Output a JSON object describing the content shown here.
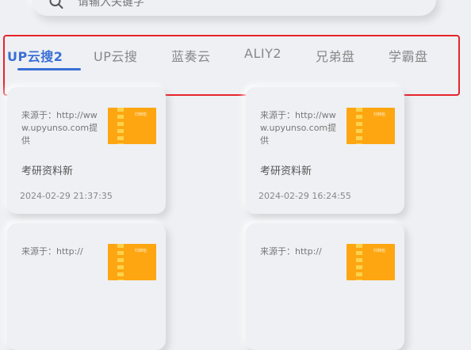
{
  "search": {
    "placeholder": "请输入关键字"
  },
  "tabs": [
    {
      "label": "UP云搜2",
      "active": true
    },
    {
      "label": "UP云搜",
      "active": false
    },
    {
      "label": "蓝奏云",
      "active": false
    },
    {
      "label": "ALIY2",
      "active": false
    },
    {
      "label": "兄弟盘",
      "active": false
    },
    {
      "label": "学霸盘",
      "active": false
    }
  ],
  "results": [
    {
      "source": "来源于：http://www.upyunso.com提供",
      "thumb_label": "归档包",
      "title": "考研资料新",
      "date": "2024-02-29 21:37:35"
    },
    {
      "source": "来源于：http://www.upyunso.com提供",
      "thumb_label": "归档包",
      "title": "考研资料新",
      "date": "2024-02-29 16:24:55"
    },
    {
      "source": "来源于：http://",
      "thumb_label": "归档包",
      "title": "",
      "date": ""
    },
    {
      "source": "来源于：http://",
      "thumb_label": "归档包",
      "title": "",
      "date": ""
    }
  ],
  "colors": {
    "background": "#eef0f3",
    "accent": "#3a6fd6",
    "highlight": "#e8242c",
    "thumbnail": "#fda611"
  }
}
